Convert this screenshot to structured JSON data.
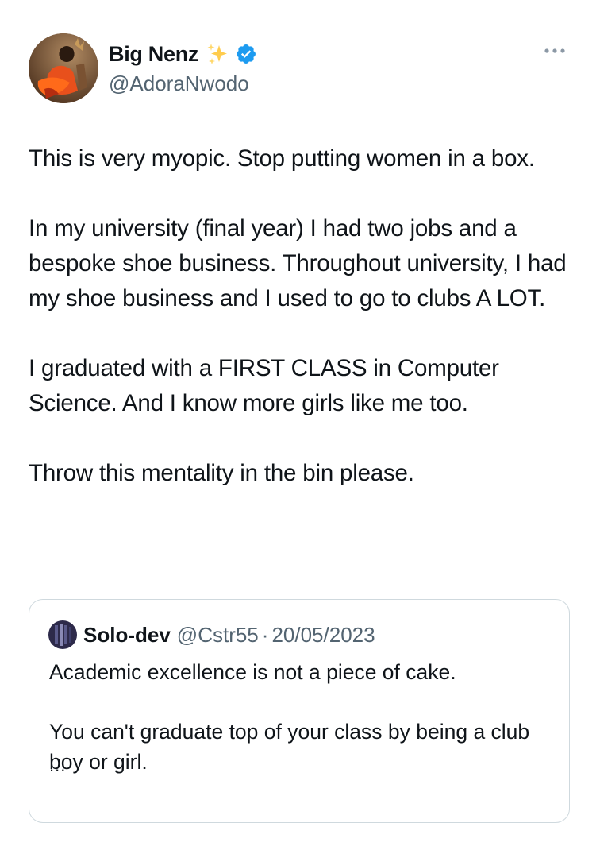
{
  "author": {
    "display_name": "Big Nenz",
    "handle": "@AdoraNwodo",
    "avatar_icon": "profile-photo",
    "badge_icon": "sparkles-emoji",
    "verified_icon": "verified-badge",
    "verified_color": "#1d9bf0"
  },
  "menu": {
    "icon": "more-horizontal-icon"
  },
  "tweet": {
    "paragraphs": [
      "This is very myopic. Stop putting women in a box.",
      "In my university (final year) I had two jobs and a bespoke shoe business. Throughout university, I had my shoe business and I used to go to clubs A LOT.",
      "I graduated with a FIRST CLASS in Computer Science. And I know more girls like me too.",
      "Throw this mentality in the bin please."
    ]
  },
  "quoted": {
    "display_name": "Solo-dev",
    "handle": "@Cstr55",
    "separator": "·",
    "date": "20/05/2023",
    "paragraphs": [
      "Academic excellence is not a piece of cake.",
      "You can't graduate top of your class by being a club boy or girl."
    ],
    "truncation": "..."
  },
  "colors": {
    "text_primary": "#0f1419",
    "text_secondary": "#536471",
    "border": "#cfd9de"
  }
}
